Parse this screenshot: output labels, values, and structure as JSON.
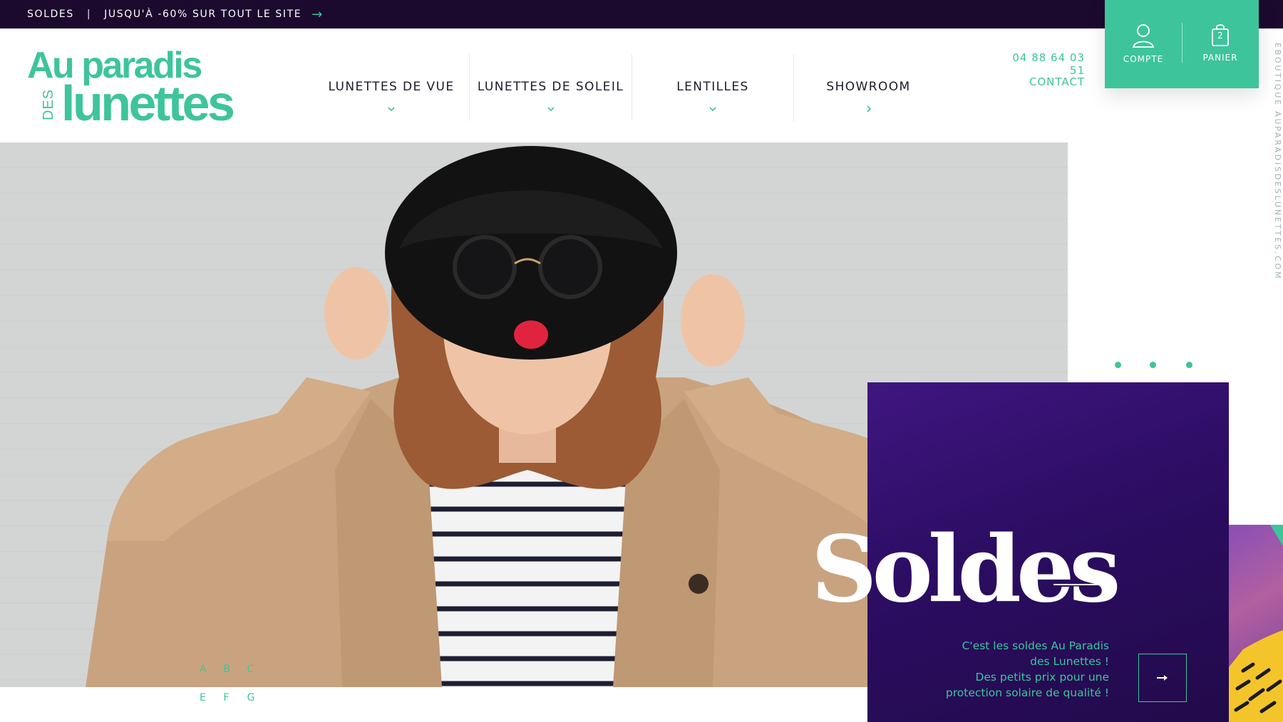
{
  "promo_bar": {
    "label": "SOLDES",
    "separator": "|",
    "text": "JUSQU'À -60% SUR TOUT LE SITE",
    "arrow_icon": "arrow-right-icon"
  },
  "logo": {
    "line1": "Au paradis",
    "small": "DES",
    "line2": "lunettes"
  },
  "nav": {
    "items": [
      {
        "label": "LUNETTES DE VUE",
        "icon": "chevron-down-icon"
      },
      {
        "label": "LUNETTES DE SOLEIL",
        "icon": "chevron-down-icon"
      },
      {
        "label": "LENTILLES",
        "icon": "chevron-down-icon"
      },
      {
        "label": "SHOWROOM",
        "icon": "chevron-right-icon"
      }
    ]
  },
  "header_contact": {
    "phone": "04 88 64 03 51",
    "contact": "CONTACT"
  },
  "account": {
    "account_label": "COMPTE",
    "cart_label": "PANIER",
    "cart_count": "2"
  },
  "side_text": "EBOUTIQUE AUPARADISDESLUNETTES.COM",
  "letters": {
    "row1": [
      "A",
      "B",
      "C"
    ],
    "row2": [
      "E",
      "F",
      "G"
    ]
  },
  "hero_promo": {
    "title": "Soldes",
    "text_lines": [
      "C'est les soldes Au Paradis",
      "des Lunettes !",
      "Des petits prix pour une",
      "protection solaire de qualité !"
    ],
    "cta_icon": "arrow-right-icon"
  },
  "colors": {
    "accent": "#3ec49b",
    "dark": "#1b0a2e",
    "panel": "#2c0d63"
  }
}
